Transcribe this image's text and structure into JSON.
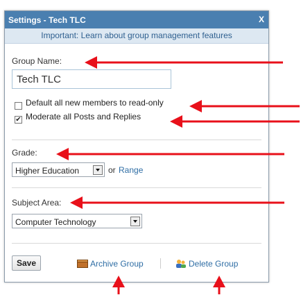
{
  "dialog": {
    "title": "Settings - Tech TLC",
    "close_label": "X",
    "notice": "Important: Learn about group management features"
  },
  "group_name": {
    "label": "Group Name:",
    "value": "Tech TLC"
  },
  "options": {
    "readonly_label": "Default all new members to read-only",
    "readonly_checked": false,
    "moderate_label": "Moderate all Posts and Replies",
    "moderate_checked": true
  },
  "grade": {
    "label": "Grade:",
    "selected": "Higher Education",
    "or_text": "or",
    "range_link": "Range"
  },
  "subject": {
    "label": "Subject Area:",
    "selected": "Computer Technology"
  },
  "footer": {
    "save": "Save",
    "archive": "Archive Group",
    "delete": "Delete Group"
  },
  "annotation_color": "#e8101a"
}
